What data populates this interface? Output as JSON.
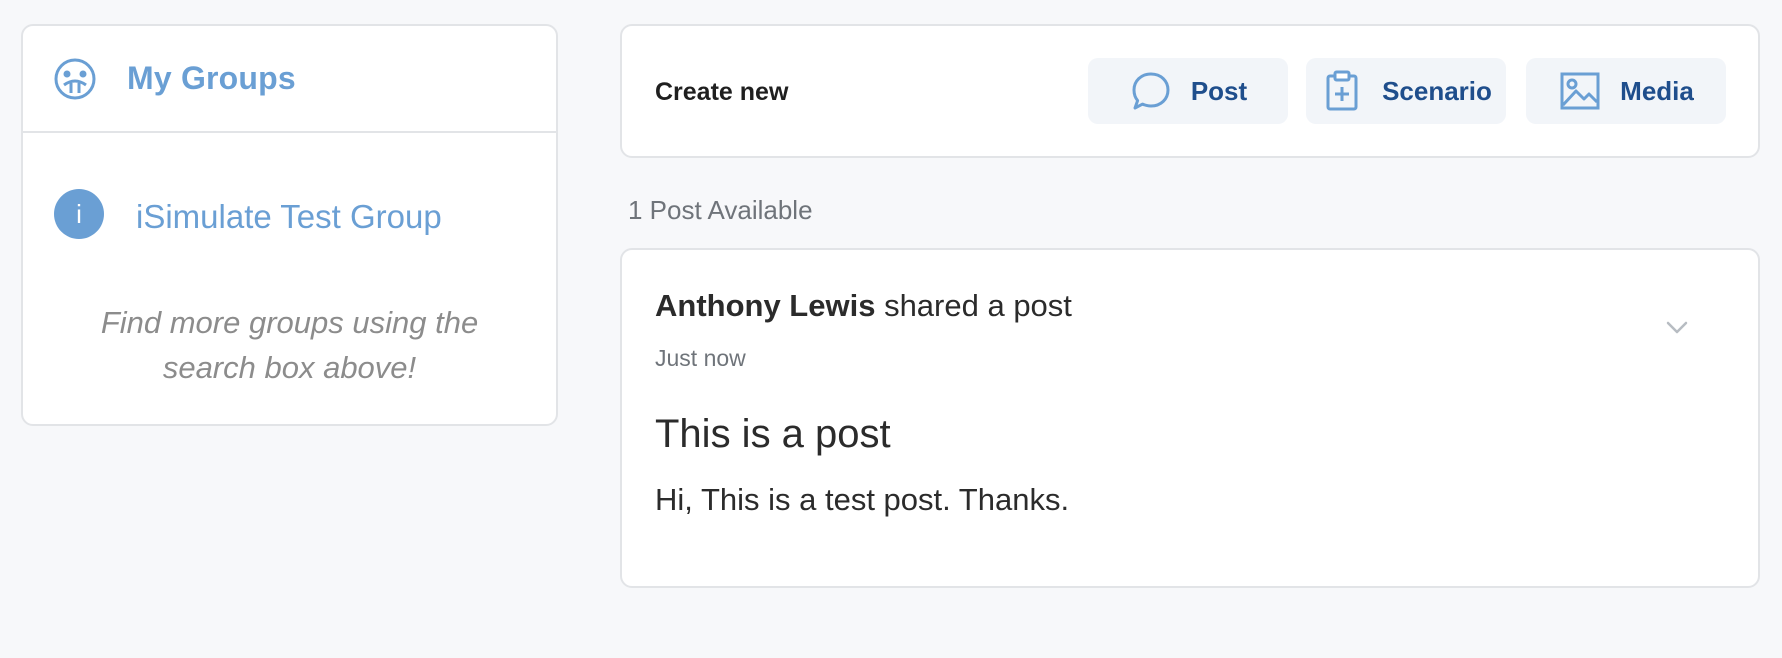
{
  "sidebar": {
    "header": {
      "icon": "groups-icon",
      "title": "My Groups"
    },
    "groups": [
      {
        "avatar_letter": "i",
        "name": "iSimulate Test Group"
      }
    ],
    "hint": "Find more groups using the search box above!"
  },
  "create": {
    "label": "Create new",
    "buttons": [
      {
        "label": "Post",
        "icon": "chat-bubble-icon"
      },
      {
        "label": "Scenario",
        "icon": "clipboard-plus-icon"
      },
      {
        "label": "Media",
        "icon": "image-icon"
      }
    ]
  },
  "feed": {
    "count_label": "1 Post Available",
    "posts": [
      {
        "author": "Anthony Lewis",
        "action": " shared a post",
        "time": "Just now",
        "title": "This is a post",
        "body": "Hi, This is a test post. Thanks."
      }
    ]
  },
  "colors": {
    "accent": "#6a9fd4",
    "button_text": "#1f4e8c",
    "background": "#f7f8fa"
  }
}
